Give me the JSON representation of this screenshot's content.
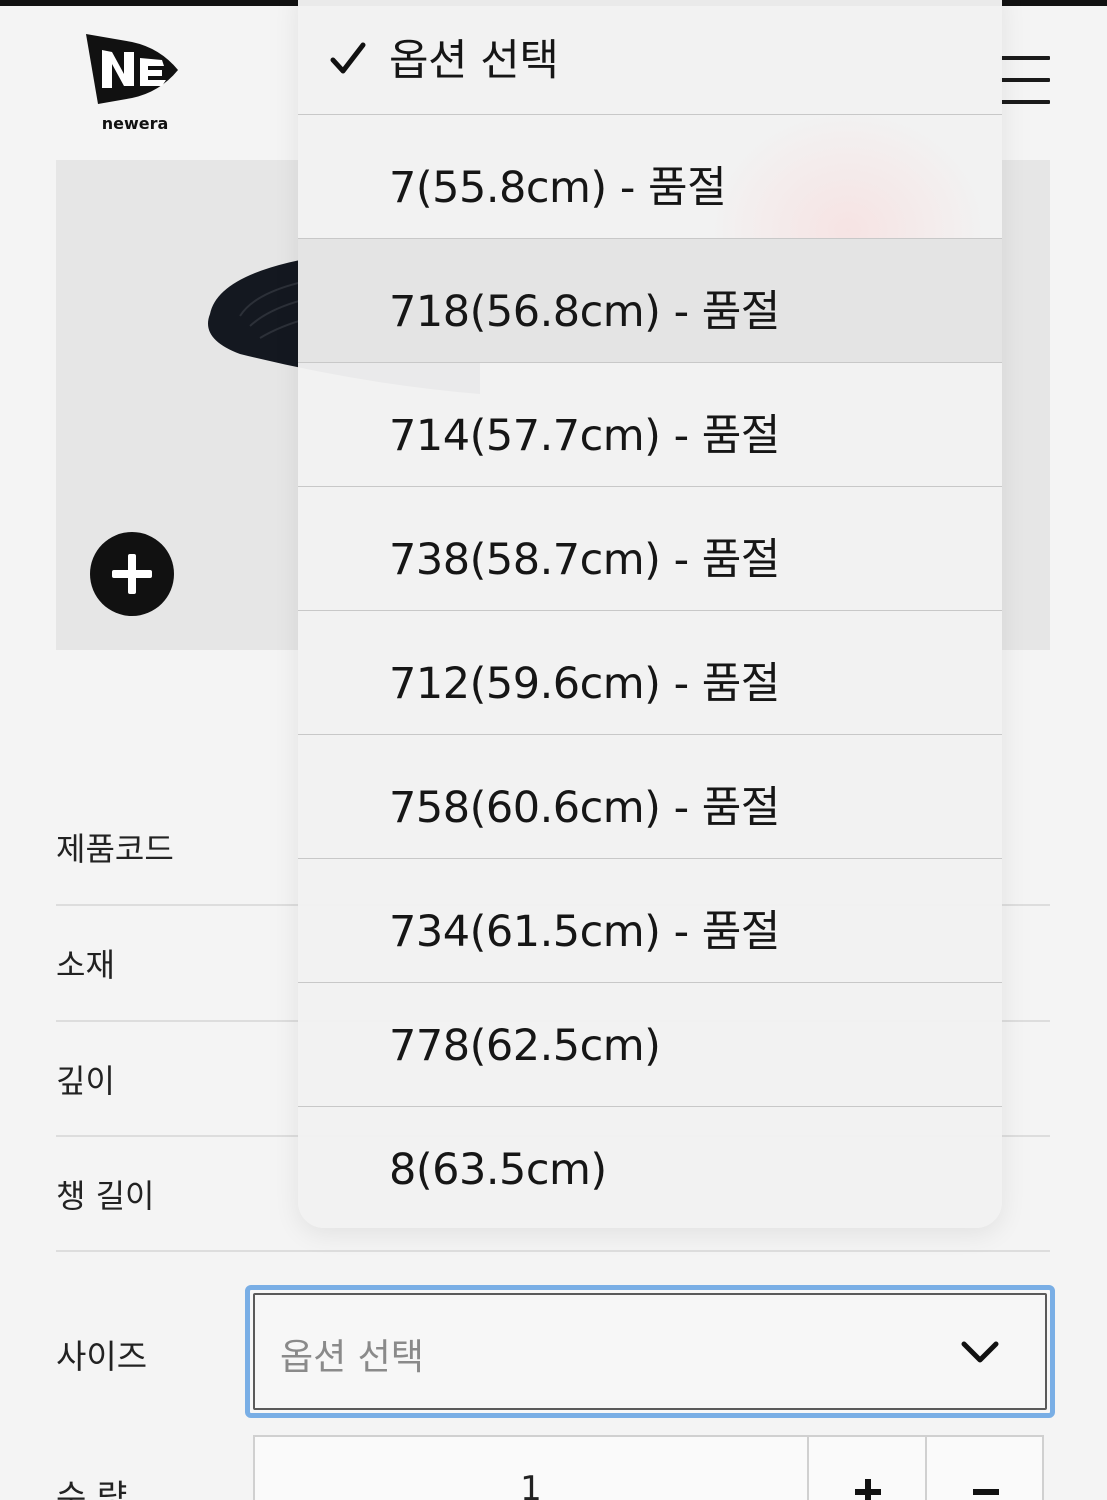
{
  "brand": {
    "logo_text": "NEW ERA",
    "logo_subtext": "newera"
  },
  "header": {
    "menu_icon": "hamburger-menu-icon"
  },
  "product": {
    "zoom_icon": "plus-icon",
    "info_rows": [
      {
        "label": "제품코드"
      },
      {
        "label": "소재"
      },
      {
        "label": "깊이"
      },
      {
        "label": "챙 길이"
      }
    ]
  },
  "size": {
    "label": "사이즈",
    "selected": "옵션 선택",
    "chevron_icon": "chevron-down-icon",
    "options": [
      {
        "label": "옵션 선택",
        "checked": true
      },
      {
        "label": "7(55.8cm) - 품절"
      },
      {
        "label": "718(56.8cm) - 품절",
        "highlighted": true
      },
      {
        "label": "714(57.7cm) - 품절"
      },
      {
        "label": "738(58.7cm) - 품절"
      },
      {
        "label": "712(59.6cm) - 품절"
      },
      {
        "label": "758(60.6cm) - 품절"
      },
      {
        "label": "734(61.5cm) - 품절"
      },
      {
        "label": "778(62.5cm)"
      },
      {
        "label": "8(63.5cm)"
      }
    ]
  },
  "quantity": {
    "label": "수 량",
    "value": "1",
    "plus_icon": "plus-icon",
    "minus_icon": "minus-icon"
  },
  "colors": {
    "accent_border": "#79aee5",
    "text": "#161616",
    "placeholder": "#8a8a8a"
  }
}
